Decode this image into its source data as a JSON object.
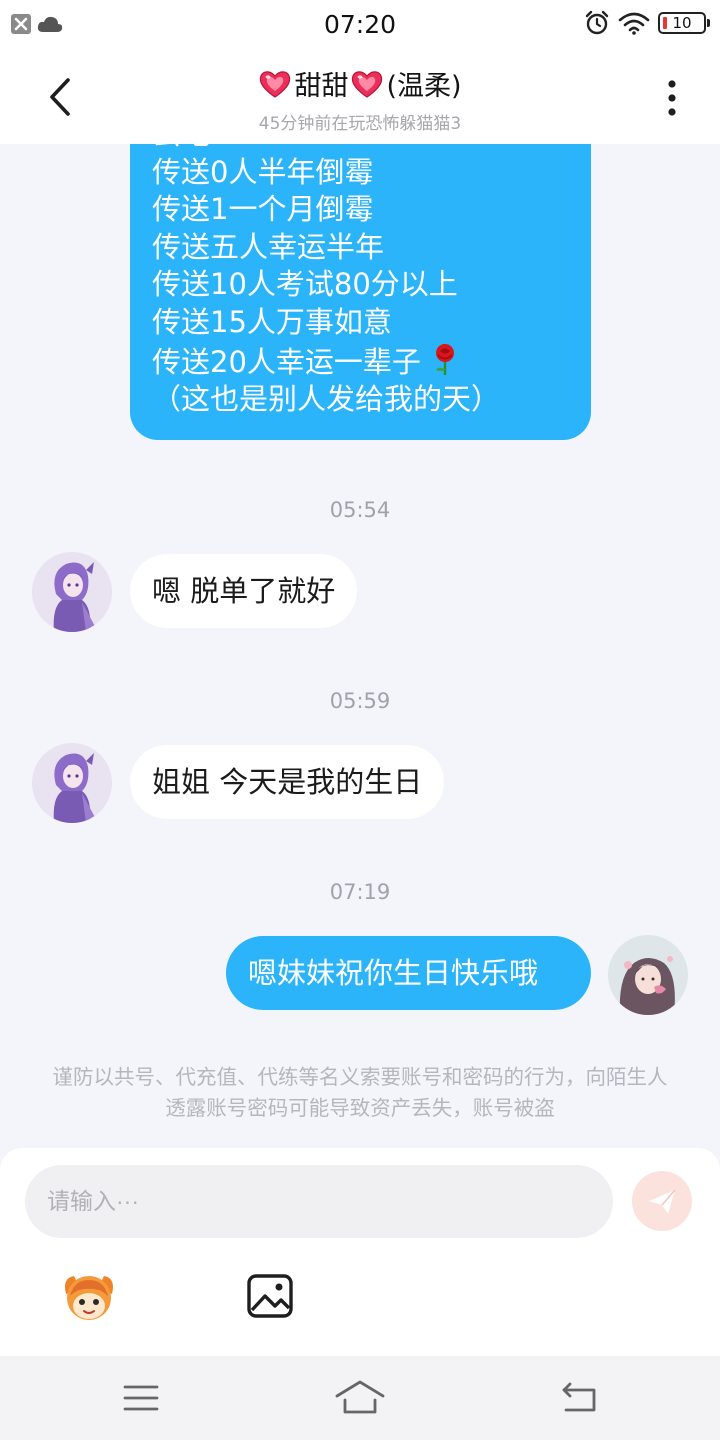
{
  "status_bar": {
    "time": "07:20",
    "battery_level": "10",
    "icons": [
      "notification-blocked-icon",
      "cloud-icon",
      "alarm-icon",
      "wifi-icon",
      "battery-icon"
    ]
  },
  "header": {
    "title_prefix_emoji": "heart-emoji",
    "title_main": "甜甜",
    "title_suffix": "(温柔)",
    "subtitle": "45分钟前在玩恐怖躲猫猫3"
  },
  "chat": {
    "messages": [
      {
        "direction": "out",
        "truncated_top": true,
        "lines": [
          "云吧",
          "传送0人半年倒霉",
          "传送1一个月倒霉",
          "传送五人幸运半年",
          "传送10人考试80分以上",
          "传送15人万事如意",
          "传送20人幸运一辈子",
          "（这也是别人发给我的天）"
        ],
        "trailing_emoji": "rose-emoji"
      },
      {
        "timestamp": "05:54"
      },
      {
        "direction": "in",
        "text": "嗯 脱单了就好"
      },
      {
        "timestamp": "05:59"
      },
      {
        "direction": "in",
        "text": "姐姐 今天是我的生日"
      },
      {
        "timestamp": "07:19"
      },
      {
        "direction": "out",
        "text": "嗯妹妹祝你生日快乐哦"
      }
    ],
    "notice": "谨防以共号、代充值、代练等名义索要账号和密码的行为，向陌生人透露账号密码可能导致资产丢失，账号被盗"
  },
  "composer": {
    "placeholder": "请输入···",
    "send_icon": "paper-plane-icon",
    "tools": [
      "game-mascot-icon",
      "image-icon"
    ]
  },
  "nav_bar": {
    "buttons": [
      "menu-icon",
      "home-icon",
      "back-icon"
    ]
  },
  "colors": {
    "accent_blue": "#2bb4fa",
    "background": "#f3f5fa",
    "send_button": "#fbe2dd",
    "battery_low": "#e53935"
  }
}
